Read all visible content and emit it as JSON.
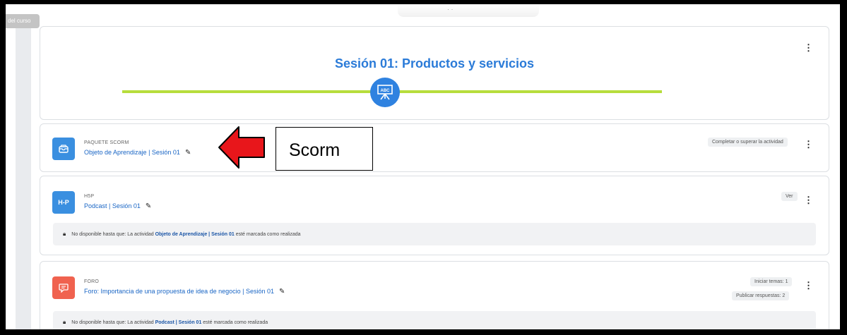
{
  "sidebar": {
    "tab_label": "del curso"
  },
  "section": {
    "title": "Sesión 01: Productos y servicios",
    "icon_text": "ABC"
  },
  "activities": [
    {
      "type_label": "PAQUETE SCORM",
      "name": "Objeto de Aprendizaje | Sesión 01",
      "badges": [
        "Completar o superar la actividad"
      ],
      "icon": "package-icon",
      "icon_color": "#3a8fe0"
    },
    {
      "type_label": "H5P",
      "name": "Podcast | Sesión 01",
      "icon_text": "H-P",
      "badges": [
        "Ver"
      ],
      "icon": "h5p-icon",
      "icon_color": "#3a8fe0",
      "restriction": {
        "prefix": "No disponible hasta que: La actividad ",
        "activity": "Objeto de Aprendizaje | Sesión 01",
        "suffix": " esté marcada como realizada"
      }
    },
    {
      "type_label": "FORO",
      "name": "Foro: Importancia de una propuesta de idea de negocio | Sesión 01",
      "badges": [
        "Iniciar temas: 1",
        "Publicar respuestas: 2"
      ],
      "icon": "forum-icon",
      "icon_color": "#f0624f",
      "restriction": {
        "prefix": "No disponible hasta que: La actividad ",
        "activity": "Podcast | Sesión 01",
        "suffix": " esté marcada como realizada"
      }
    }
  ],
  "annotation": {
    "label": "Scorm",
    "arrow_color": "#e8161b"
  },
  "colors": {
    "accent": "#2b7bd8",
    "divider": "#b7dd3c"
  }
}
